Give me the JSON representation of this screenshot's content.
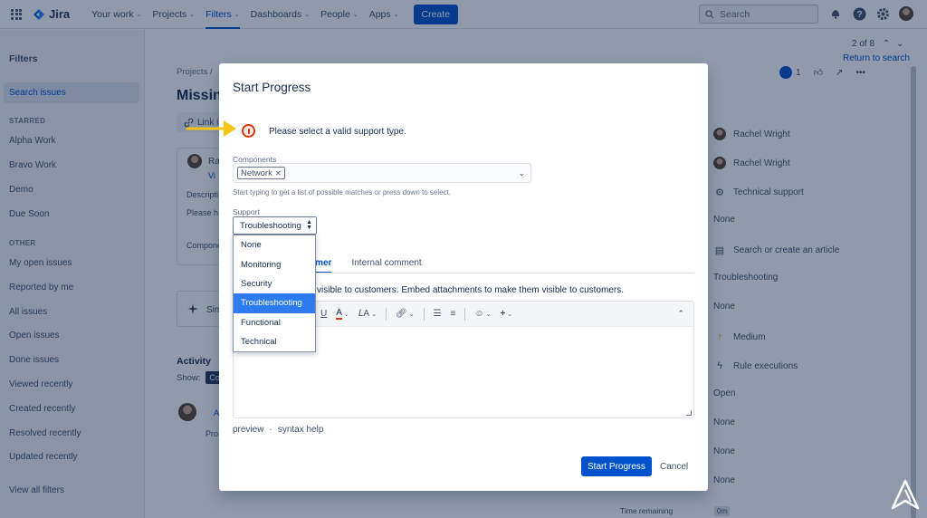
{
  "nav": {
    "logo": "Jira",
    "items": [
      {
        "label": "Your work",
        "chevron": true
      },
      {
        "label": "Projects",
        "chevron": true
      },
      {
        "label": "Filters",
        "chevron": true,
        "active": true
      },
      {
        "label": "Dashboards",
        "chevron": true
      },
      {
        "label": "People",
        "chevron": true
      },
      {
        "label": "Apps",
        "chevron": true
      }
    ],
    "create_label": "Create",
    "search_placeholder": "Search",
    "icons": [
      "notifications-icon",
      "help-icon",
      "settings-icon",
      "avatar"
    ]
  },
  "sidebar": {
    "title": "Filters",
    "search_issues": "Search issues",
    "starred_heading": "STARRED",
    "starred": [
      "Alpha Work",
      "Bravo Work",
      "Demo",
      "Due Soon"
    ],
    "other_heading": "OTHER",
    "other": [
      "My open issues",
      "Reported by me",
      "All issues",
      "Open issues",
      "Done issues",
      "Viewed recently",
      "Created recently",
      "Resolved recently",
      "Updated recently"
    ],
    "view_all": "View all filters"
  },
  "issue": {
    "breadcrumb": "Projects /",
    "title_partial": "Missin",
    "link_label": "Link i",
    "reporter_initials": "Ra",
    "reporter_sub": "Vi",
    "description_label": "Descripti",
    "description_text": "Please h",
    "components_label": "Compone",
    "similar_label": "Sim",
    "activity_label": "Activity",
    "show_label": "Show:",
    "show_pill": "Co",
    "comment_author": "A",
    "comment_sub": "Pro",
    "pager": "2 of 8",
    "return_link": "Return to search",
    "watch_count": "1",
    "time_remaining_label": "Time remaining",
    "time_remaining_value": "0m"
  },
  "right_panel": [
    {
      "icon": "avatar",
      "text": "Rachel Wright"
    },
    {
      "icon": "avatar",
      "text": "Rachel Wright"
    },
    {
      "icon": "gear-icon",
      "text": "Technical support"
    },
    {
      "icon": "",
      "text": "None"
    },
    {
      "icon": "article-icon",
      "text": "Search or create an article"
    },
    {
      "icon": "",
      "text": "Troubleshooting"
    },
    {
      "icon": "",
      "text": "None"
    },
    {
      "icon": "arrow-up-icon",
      "text": "Medium"
    },
    {
      "icon": "lightning-icon",
      "text": "Rule executions"
    },
    {
      "icon": "",
      "text": "Open"
    },
    {
      "icon": "",
      "text": "None"
    },
    {
      "icon": "",
      "text": "None"
    },
    {
      "icon": "",
      "text": "None"
    }
  ],
  "modal": {
    "title": "Start Progress",
    "error": "Please select a valid support type.",
    "components_label": "Components",
    "components_tag": "Network",
    "components_hint": "Start typing to get a list of possible matches or press down to select.",
    "support_label": "Support",
    "support_value": "Troubleshooting",
    "support_options": [
      "None",
      "Monitoring",
      "Security",
      "Troubleshooting",
      "Functional",
      "Technical"
    ],
    "support_selected_index": 3,
    "tab_customer": "omer",
    "tab_internal": "Internal comment",
    "visible_note": "visible to customers. Embed attachments to make them visible to customers.",
    "preview_link": "preview",
    "dot": "·",
    "syntax_help": "syntax help",
    "primary_button": "Start Progress",
    "cancel_button": "Cancel"
  },
  "colors": {
    "brand": "#0052cc",
    "error": "#de350b",
    "annotation_arrow": "#f5c518",
    "option_highlight": "#2e7bf0"
  }
}
